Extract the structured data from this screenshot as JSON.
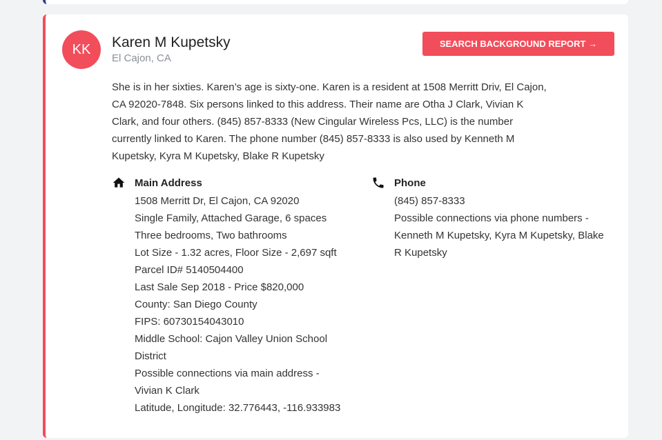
{
  "person": {
    "initials": "KK",
    "name": "Karen M Kupetsky",
    "location": "El Cajon, CA",
    "button_label": "SEARCH BACKGROUND REPORT →",
    "description": "She is in her sixties. Karen’s age is sixty-one. Karen is a resident at 1508 Merritt Driv, El Cajon, CA 92020-7848. Six persons linked to this address. Their name are Otha J Clark, Vivian K Clark, and four others. (845) 857-8333 (New Cingular Wireless Pcs, LLC) is the number currently linked to Karen. The phone number (845) 857-8333 is also used by Kenneth M Kupetsky, Kyra M Kupetsky, Blake R Kupetsky"
  },
  "address": {
    "title": "Main Address",
    "lines": [
      "1508 Merritt Dr, El Cajon, CA 92020",
      "Single Family, Attached Garage, 6 spaces",
      "Three bedrooms, Two bathrooms",
      "Lot Size - 1.32 acres, Floor Size - 2,697 sqft",
      "Parcel ID# 5140504400",
      "Last Sale Sep 2018 - Price $820,000",
      "County: San Diego County",
      "FIPS: 60730154043010",
      "Middle School: Cajon Valley Union School District",
      "Possible connections via main address - Vivian K Clark",
      "Latitude, Longitude: 32.776443, -116.933983"
    ]
  },
  "phone": {
    "title": "Phone",
    "lines": [
      "(845) 857-8333",
      "Possible connections via phone numbers - Kenneth M Kupetsky, Kyra M Kupetsky, Blake R Kupetsky"
    ]
  },
  "colors": {
    "accent": "#f24d5b",
    "top_border": "#2c3e8f"
  },
  "icons": {
    "address": "home-icon",
    "phone": "phone-icon"
  }
}
